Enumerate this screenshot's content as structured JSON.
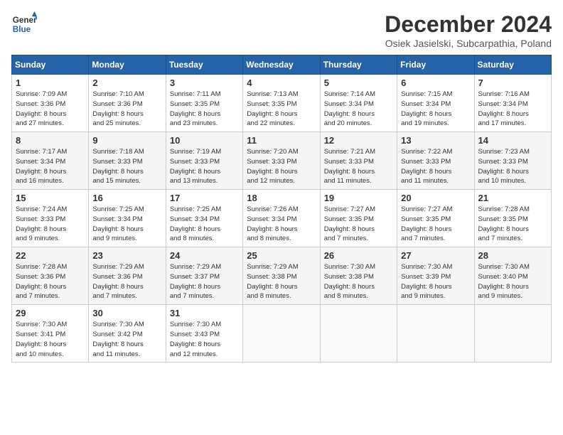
{
  "logo": {
    "line1": "General",
    "line2": "Blue"
  },
  "title": "December 2024",
  "subtitle": "Osiek Jasielski, Subcarpathia, Poland",
  "days_header": [
    "Sunday",
    "Monday",
    "Tuesday",
    "Wednesday",
    "Thursday",
    "Friday",
    "Saturday"
  ],
  "weeks": [
    [
      {
        "day": "1",
        "info": "Sunrise: 7:09 AM\nSunset: 3:36 PM\nDaylight: 8 hours\nand 27 minutes."
      },
      {
        "day": "2",
        "info": "Sunrise: 7:10 AM\nSunset: 3:36 PM\nDaylight: 8 hours\nand 25 minutes."
      },
      {
        "day": "3",
        "info": "Sunrise: 7:11 AM\nSunset: 3:35 PM\nDaylight: 8 hours\nand 23 minutes."
      },
      {
        "day": "4",
        "info": "Sunrise: 7:13 AM\nSunset: 3:35 PM\nDaylight: 8 hours\nand 22 minutes."
      },
      {
        "day": "5",
        "info": "Sunrise: 7:14 AM\nSunset: 3:34 PM\nDaylight: 8 hours\nand 20 minutes."
      },
      {
        "day": "6",
        "info": "Sunrise: 7:15 AM\nSunset: 3:34 PM\nDaylight: 8 hours\nand 19 minutes."
      },
      {
        "day": "7",
        "info": "Sunrise: 7:16 AM\nSunset: 3:34 PM\nDaylight: 8 hours\nand 17 minutes."
      }
    ],
    [
      {
        "day": "8",
        "info": "Sunrise: 7:17 AM\nSunset: 3:34 PM\nDaylight: 8 hours\nand 16 minutes."
      },
      {
        "day": "9",
        "info": "Sunrise: 7:18 AM\nSunset: 3:33 PM\nDaylight: 8 hours\nand 15 minutes."
      },
      {
        "day": "10",
        "info": "Sunrise: 7:19 AM\nSunset: 3:33 PM\nDaylight: 8 hours\nand 13 minutes."
      },
      {
        "day": "11",
        "info": "Sunrise: 7:20 AM\nSunset: 3:33 PM\nDaylight: 8 hours\nand 12 minutes."
      },
      {
        "day": "12",
        "info": "Sunrise: 7:21 AM\nSunset: 3:33 PM\nDaylight: 8 hours\nand 11 minutes."
      },
      {
        "day": "13",
        "info": "Sunrise: 7:22 AM\nSunset: 3:33 PM\nDaylight: 8 hours\nand 11 minutes."
      },
      {
        "day": "14",
        "info": "Sunrise: 7:23 AM\nSunset: 3:33 PM\nDaylight: 8 hours\nand 10 minutes."
      }
    ],
    [
      {
        "day": "15",
        "info": "Sunrise: 7:24 AM\nSunset: 3:33 PM\nDaylight: 8 hours\nand 9 minutes."
      },
      {
        "day": "16",
        "info": "Sunrise: 7:25 AM\nSunset: 3:34 PM\nDaylight: 8 hours\nand 9 minutes."
      },
      {
        "day": "17",
        "info": "Sunrise: 7:25 AM\nSunset: 3:34 PM\nDaylight: 8 hours\nand 8 minutes."
      },
      {
        "day": "18",
        "info": "Sunrise: 7:26 AM\nSunset: 3:34 PM\nDaylight: 8 hours\nand 8 minutes."
      },
      {
        "day": "19",
        "info": "Sunrise: 7:27 AM\nSunset: 3:35 PM\nDaylight: 8 hours\nand 7 minutes."
      },
      {
        "day": "20",
        "info": "Sunrise: 7:27 AM\nSunset: 3:35 PM\nDaylight: 8 hours\nand 7 minutes."
      },
      {
        "day": "21",
        "info": "Sunrise: 7:28 AM\nSunset: 3:35 PM\nDaylight: 8 hours\nand 7 minutes."
      }
    ],
    [
      {
        "day": "22",
        "info": "Sunrise: 7:28 AM\nSunset: 3:36 PM\nDaylight: 8 hours\nand 7 minutes."
      },
      {
        "day": "23",
        "info": "Sunrise: 7:29 AM\nSunset: 3:36 PM\nDaylight: 8 hours\nand 7 minutes."
      },
      {
        "day": "24",
        "info": "Sunrise: 7:29 AM\nSunset: 3:37 PM\nDaylight: 8 hours\nand 7 minutes."
      },
      {
        "day": "25",
        "info": "Sunrise: 7:29 AM\nSunset: 3:38 PM\nDaylight: 8 hours\nand 8 minutes."
      },
      {
        "day": "26",
        "info": "Sunrise: 7:30 AM\nSunset: 3:38 PM\nDaylight: 8 hours\nand 8 minutes."
      },
      {
        "day": "27",
        "info": "Sunrise: 7:30 AM\nSunset: 3:39 PM\nDaylight: 8 hours\nand 9 minutes."
      },
      {
        "day": "28",
        "info": "Sunrise: 7:30 AM\nSunset: 3:40 PM\nDaylight: 8 hours\nand 9 minutes."
      }
    ],
    [
      {
        "day": "29",
        "info": "Sunrise: 7:30 AM\nSunset: 3:41 PM\nDaylight: 8 hours\nand 10 minutes."
      },
      {
        "day": "30",
        "info": "Sunrise: 7:30 AM\nSunset: 3:42 PM\nDaylight: 8 hours\nand 11 minutes."
      },
      {
        "day": "31",
        "info": "Sunrise: 7:30 AM\nSunset: 3:43 PM\nDaylight: 8 hours\nand 12 minutes."
      },
      {
        "day": "",
        "info": ""
      },
      {
        "day": "",
        "info": ""
      },
      {
        "day": "",
        "info": ""
      },
      {
        "day": "",
        "info": ""
      }
    ]
  ]
}
